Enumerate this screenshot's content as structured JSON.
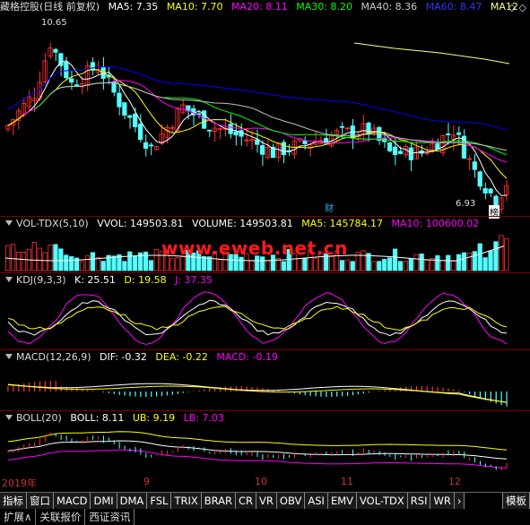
{
  "main": {
    "title": "藏格控股(日线 前复权)",
    "ma5": "MA5: 7.35",
    "ma10": "MA10: 7.70",
    "ma20": "MA20: 8.11",
    "ma30": "MA30: 8.20",
    "ma40": "MA40: 8.36",
    "ma60": "MA60: 8.47",
    "ma120": "MA12",
    "high_label": "10.65",
    "low_label": "6.93",
    "cai_marker": "财",
    "bang_marker": "榜",
    "nav_arrows": "◇ ◇"
  },
  "vol": {
    "name": "VOL-TDX(5,10)",
    "vvol": "VVOL: 149503.81",
    "volume": "VOLUME: 149503.81",
    "ma5": "MA5: 145784.17",
    "ma10": "MA10: 100600.02"
  },
  "kdj": {
    "name": "KDJ(9,3,3)",
    "k": "K: 25.51",
    "d": "D: 19.58",
    "j": "J: 37.35"
  },
  "macd": {
    "name": "MACD(12,26,9)",
    "dif": "DIF: -0.32",
    "dea": "DEA: -0.22",
    "macd": "MACD: -0.19"
  },
  "boll": {
    "name": "BOLL(20)",
    "boll": "BOLL: 8.11",
    "ub": "UB: 9.19",
    "lb": "LB: 7.03"
  },
  "watermark": "www.eweb.net.cn",
  "date_axis": [
    "2019年",
    "9",
    "10",
    "11",
    "12"
  ],
  "tabs": [
    "指标",
    "窗口",
    "MACD",
    "DMI",
    "DMA",
    "FSL",
    "TRIX",
    "BRAR",
    "CR",
    "VR",
    "OBV",
    "ASI",
    "EMV",
    "VOL-TDX",
    "RSI",
    "WR",
    "›"
  ],
  "tab_right": "模板",
  "bottom_tabs": [
    "扩展∧",
    "关联报价",
    "西证资讯"
  ],
  "colors": {
    "up": "#ff3232",
    "down": "#54ffff",
    "ma5": "#ffffff",
    "ma10": "#ffff00",
    "ma20": "#ff00ff",
    "ma30": "#00ff00",
    "ma40": "#c0c0c0",
    "ma60": "#0000ff",
    "ma120": "#ffff80"
  }
}
